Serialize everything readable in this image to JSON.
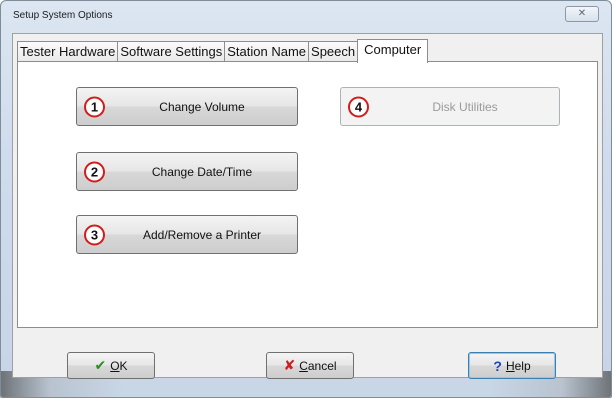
{
  "window": {
    "title": "Setup System Options",
    "close_glyph": "✕"
  },
  "tabs": [
    {
      "label": "Tester Hardware",
      "active": false
    },
    {
      "label": "Software Settings",
      "active": false
    },
    {
      "label": "Station Name",
      "active": false
    },
    {
      "label": "Speech",
      "active": false
    },
    {
      "label": "Computer",
      "active": true
    }
  ],
  "actions": [
    {
      "num": "1",
      "label": "Change Volume",
      "enabled": true
    },
    {
      "num": "2",
      "label": "Change Date/Time",
      "enabled": true
    },
    {
      "num": "3",
      "label": "Add/Remove a Printer",
      "enabled": true
    },
    {
      "num": "4",
      "label": "Disk Utilities",
      "enabled": false
    }
  ],
  "footer": {
    "ok": {
      "icon": "✔",
      "label_u": "O",
      "label_rest": "K"
    },
    "cancel": {
      "icon": "✘",
      "label_u": "C",
      "label_rest": "ancel"
    },
    "help": {
      "icon": "?",
      "label_u": "H",
      "label_rest": "elp"
    }
  },
  "colors": {
    "annotation_circle": "#d21c1c",
    "ok_check": "#2e8b22",
    "cancel_x": "#cc1f1f",
    "help_q": "#1a47b8"
  }
}
